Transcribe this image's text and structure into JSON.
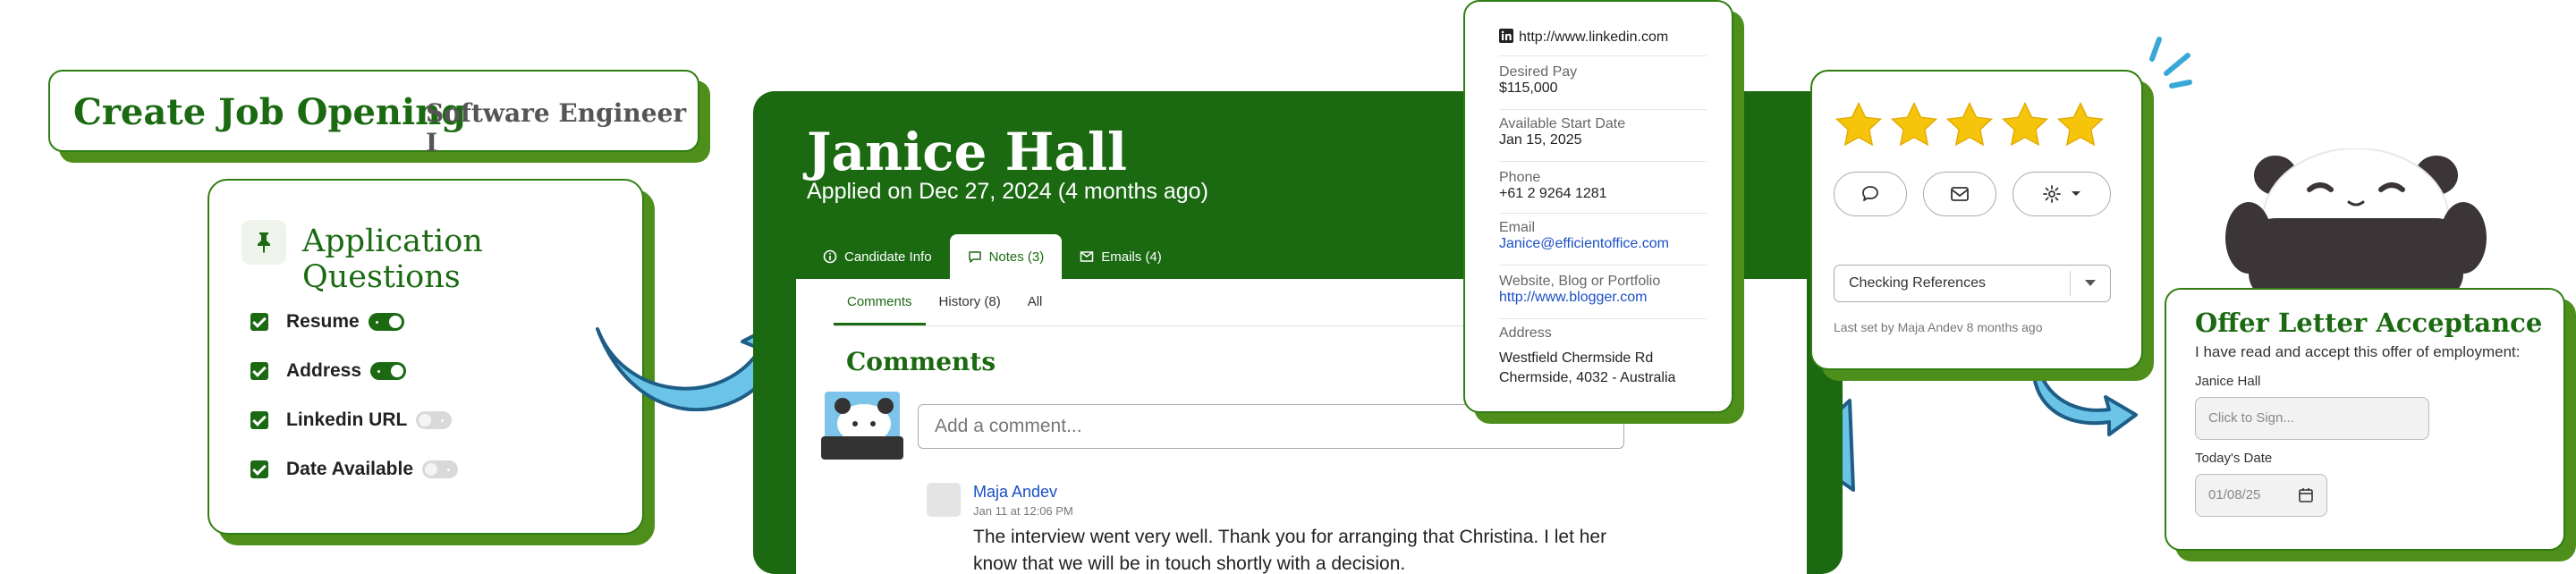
{
  "job": {
    "title": "Create Job Opening",
    "subtitle": "Software Engineer I"
  },
  "questions": {
    "title": "Application Questions",
    "items": [
      {
        "label": "Resume",
        "toggle": "on"
      },
      {
        "label": "Address",
        "toggle": "on"
      },
      {
        "label": "Linkedin URL",
        "toggle": "off"
      },
      {
        "label": "Date Available",
        "toggle": "off"
      }
    ]
  },
  "candidate": {
    "name": "Janice Hall",
    "applied": "Applied on Dec 27, 2024 (4 months ago)",
    "tabs": [
      {
        "label": "Candidate Info",
        "icon": "info-icon",
        "active": false
      },
      {
        "label": "Notes (3)",
        "icon": "chat-icon",
        "active": true
      },
      {
        "label": "Emails (4)",
        "icon": "mail-icon",
        "active": false
      }
    ],
    "subtabs": [
      {
        "label": "Comments",
        "active": true
      },
      {
        "label": "History (8)",
        "active": false
      },
      {
        "label": "All",
        "active": false
      }
    ],
    "comments_heading": "Comments",
    "comment_placeholder": "Add a comment...",
    "comment": {
      "author": "Maja Andev",
      "time": "Jan 11 at 12:06 PM",
      "text": "The interview went very well. Thank you for arranging that Christina. I let her know that we will be in touch shortly with a decision."
    }
  },
  "info": {
    "linkedin": "http://www.linkedin.com",
    "desired_pay_label": "Desired Pay",
    "desired_pay": "$115,000",
    "start_label": "Available Start Date",
    "start": "Jan 15, 2025",
    "phone_label": "Phone",
    "phone": "+61 2 9264 1281",
    "email_label": "Email",
    "email": "Janice@efficientoffice.com",
    "website_label": "Website, Blog or Portfolio",
    "website": "http://www.blogger.com",
    "address_label": "Address",
    "address1": "Westfield  Chermside Rd",
    "address2": "Chermside, 4032 - Australia"
  },
  "rating": {
    "stars": 5,
    "star_color": "#f6c40a",
    "status": "Checking References",
    "last_set": "Last set by Maja Andev 8 months ago"
  },
  "offer": {
    "title": "Offer Letter Acceptance",
    "desc": "I have read and accept this offer of employment:",
    "name_label": "Janice Hall",
    "sign_placeholder": "Click to Sign...",
    "date_label": "Today's Date",
    "date_value": "01/08/25"
  },
  "colors": {
    "brand_green": "#1b6a12",
    "arrow_blue": "#6cc3e8",
    "link_blue": "#1a4fc4"
  }
}
